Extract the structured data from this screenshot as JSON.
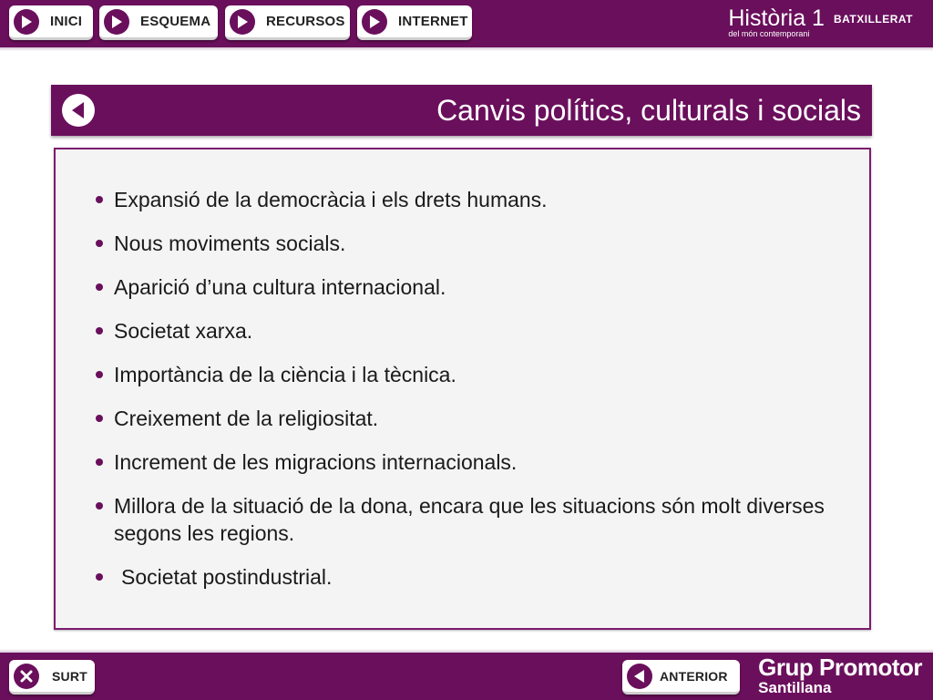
{
  "nav": {
    "items": [
      {
        "label": "INICI"
      },
      {
        "label": "ESQUEMA"
      },
      {
        "label": "RECURSOS"
      },
      {
        "label": "INTERNET"
      }
    ]
  },
  "brand": {
    "title": "Història 1",
    "level": "BATXILLERAT",
    "subtitle": "del món contemporani"
  },
  "page": {
    "title": "Canvis polítics, culturals i socials"
  },
  "content": {
    "items": [
      "Expansió de la democràcia i els drets humans.",
      "Nous moviments socials.",
      "Aparició d’una cultura internacional.",
      "Societat xarxa.",
      "Importància de la ciència i la tècnica.",
      "Creixement de la religiositat.",
      "Increment de les migracions internacionals.",
      "Millora de la situació de la dona, encara que les situacions són molt diverses segons les regions.",
      "Societat postindustrial."
    ]
  },
  "footer": {
    "exit_label": "SURT",
    "prev_label": "ANTERIOR",
    "brand_main": "Grup Promotor",
    "brand_sub": "Santillana"
  },
  "colors": {
    "accent": "#6a0f5c"
  },
  "icons": {
    "nav": "play-icon",
    "back": "back-arrow-icon",
    "exit": "close-icon",
    "prev": "prev-arrow-icon"
  }
}
